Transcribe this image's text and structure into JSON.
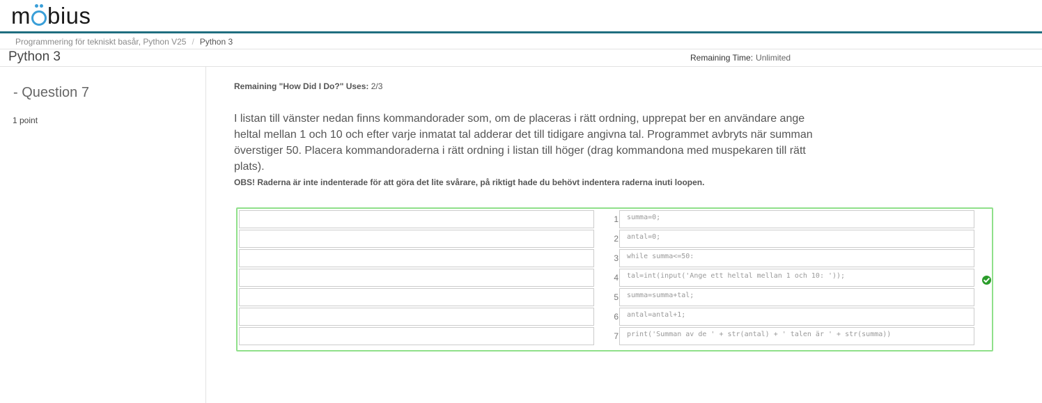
{
  "app": {
    "logo_text": "möbius"
  },
  "breadcrumb": {
    "course": "Programmering för tekniskt basår, Python V25",
    "separator": "/",
    "current": "Python 3"
  },
  "assignment": {
    "title": "Python 3",
    "remaining_time_label": "Remaining Time:",
    "remaining_time_value": "Unlimited"
  },
  "question": {
    "title": "- Question 7",
    "points": "1 point",
    "how_did_i_do_label": "Remaining \"How Did I Do?\" Uses:",
    "how_did_i_do_value": "2/3",
    "text": "I listan till vänster nedan finns kommandorader som, om de placeras i rätt ordning, upprepat ber en användare ange heltal mellan 1 och 10 och efter varje inmatat tal adderar det till tidigare angivna tal. Programmet avbryts när summan överstiger 50. Placera kommandoraderna i rätt ordning i listan till höger (drag kommandona med muspekaren till rätt plats).",
    "note": "OBS! Raderna är inte indenterade för att göra det lite svårare, på riktigt hade du behövt indentera raderna inuti loopen."
  },
  "answer": {
    "status_icon": "check-circle-icon",
    "status_color": "#2a9c2a",
    "left_slots": [
      "",
      "",
      "",
      "",
      "",
      "",
      ""
    ],
    "right_slots": [
      {
        "num": "1",
        "code": "summa=0;"
      },
      {
        "num": "2",
        "code": "antal=0;"
      },
      {
        "num": "3",
        "code": "while summa<=50:"
      },
      {
        "num": "4",
        "code": "tal=int(input('Ange ett heltal mellan 1 och 10: '));"
      },
      {
        "num": "5",
        "code": "summa=summa+tal;"
      },
      {
        "num": "6",
        "code": "antal=antal+1;"
      },
      {
        "num": "7",
        "code": "print('Summan av de ' + str(antal) + ' talen är ' + str(summa))"
      }
    ]
  }
}
